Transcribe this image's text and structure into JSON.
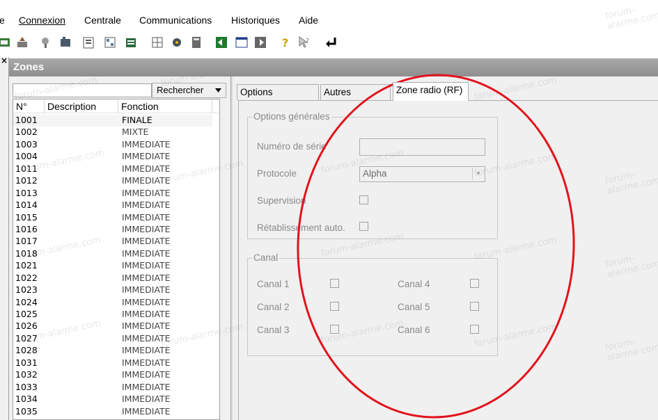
{
  "menu": [
    "e",
    "Connexion",
    "Centrale",
    "Communications",
    "Historiques",
    "Aide"
  ],
  "window_title": "Zones",
  "search_button": "Rechercher",
  "search_value": "",
  "columns": [
    "N°",
    "Description",
    "Fonction"
  ],
  "zones": [
    {
      "n": "1001",
      "f": "FINALE"
    },
    {
      "n": "1002",
      "f": "MIXTE"
    },
    {
      "n": "1003",
      "f": "IMMEDIATE"
    },
    {
      "n": "1004",
      "f": "IMMEDIATE"
    },
    {
      "n": "1011",
      "f": "IMMEDIATE"
    },
    {
      "n": "1012",
      "f": "IMMEDIATE"
    },
    {
      "n": "1013",
      "f": "IMMEDIATE"
    },
    {
      "n": "1014",
      "f": "IMMEDIATE"
    },
    {
      "n": "1015",
      "f": "IMMEDIATE"
    },
    {
      "n": "1016",
      "f": "IMMEDIATE"
    },
    {
      "n": "1017",
      "f": "IMMEDIATE"
    },
    {
      "n": "1018",
      "f": "IMMEDIATE"
    },
    {
      "n": "1021",
      "f": "IMMEDIATE"
    },
    {
      "n": "1022",
      "f": "IMMEDIATE"
    },
    {
      "n": "1023",
      "f": "IMMEDIATE"
    },
    {
      "n": "1024",
      "f": "IMMEDIATE"
    },
    {
      "n": "1025",
      "f": "IMMEDIATE"
    },
    {
      "n": "1026",
      "f": "IMMEDIATE"
    },
    {
      "n": "1027",
      "f": "IMMEDIATE"
    },
    {
      "n": "1028",
      "f": "IMMEDIATE"
    },
    {
      "n": "1031",
      "f": "IMMEDIATE"
    },
    {
      "n": "1032",
      "f": "IMMEDIATE"
    },
    {
      "n": "1033",
      "f": "IMMEDIATE"
    },
    {
      "n": "1034",
      "f": "IMMEDIATE"
    },
    {
      "n": "1035",
      "f": "IMMEDIATE"
    }
  ],
  "tabs": [
    "Options générales",
    "Autres Groupes",
    "Zone radio (RF)"
  ],
  "active_tab": "Zone radio (RF)",
  "options_group": {
    "title": "Options générales",
    "serial_label": "Numéro de série",
    "serial_value": "",
    "protocol_label": "Protocole",
    "protocol_value": "Alpha",
    "supervision_label": "Supervision",
    "auto_restore_label": "Rétablissement auto."
  },
  "canal_group": {
    "title": "Canal",
    "channels": [
      "Canal 1",
      "Canal 2",
      "Canal 3",
      "Canal 4",
      "Canal 5",
      "Canal 6"
    ]
  },
  "watermark": "forum-alarme.com",
  "colors": {
    "annotation": "#e3121c",
    "title_bar": "#9a9a9a"
  }
}
